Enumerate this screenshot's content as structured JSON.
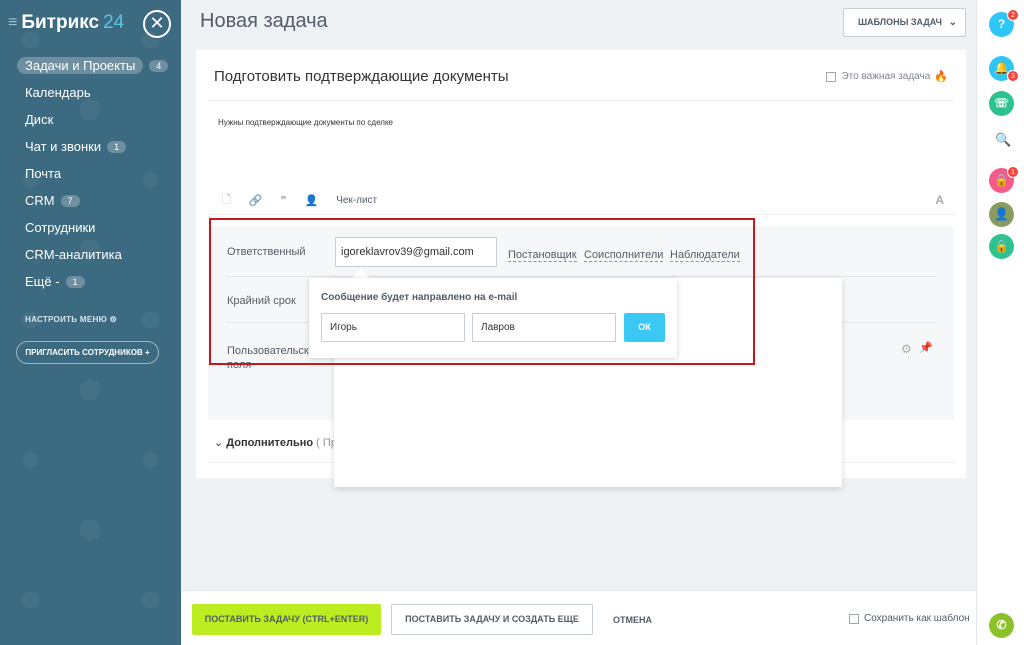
{
  "sidebar": {
    "logo_text": "Битрикс",
    "logo_num": "24",
    "items": [
      {
        "label": "Задачи и Проекты",
        "badge": "4"
      },
      {
        "label": "Календарь",
        "badge": ""
      },
      {
        "label": "Диск",
        "badge": ""
      },
      {
        "label": "Чат и звонки",
        "badge": "1"
      },
      {
        "label": "Почта",
        "badge": ""
      },
      {
        "label": "CRM",
        "badge": "7"
      },
      {
        "label": "Сотрудники",
        "badge": ""
      },
      {
        "label": "CRM-аналитика",
        "badge": ""
      },
      {
        "label": "Ещё -",
        "badge": "1"
      }
    ],
    "settings_label": "НАСТРОИТЬ МЕНЮ",
    "invite_label": "ПРИГЛАСИТЬ СОТРУДНИКОВ"
  },
  "header": {
    "title": "Новая задача",
    "templates_button": "ШАБЛОНЫ ЗАДАЧ"
  },
  "task": {
    "title": "Подготовить подтверждающие документы",
    "important_label": "Это важная задача",
    "description": "Нужны подтверждающие документы по сделке",
    "checklist_label": "Чек-лист"
  },
  "fields": {
    "responsible_label": "Ответственный",
    "responsible_value": "igoreklavrov39@gmail.com",
    "role_links": [
      "Постановщик",
      "Соисполнители",
      "Наблюдатели"
    ],
    "deadline_label": "Крайний срок",
    "custom_label_1": "Пользовательски",
    "custom_label_2": "поля",
    "extra_label": "Дополнительно",
    "extra_hint": "( Пр"
  },
  "popup": {
    "title": "Сообщение будет направлено на e-mail",
    "first_name": "Игорь",
    "last_name": "Лавров",
    "ok_label": "ОК"
  },
  "footer": {
    "submit_label": "ПОСТАВИТЬ ЗАДАЧУ (CTRL+ENTER)",
    "submit_more_label": "ПОСТАВИТЬ ЗАДАЧУ И СОЗДАТЬ ЕЩЕ",
    "cancel_label": "ОТМЕНА",
    "save_template_label": "Сохранить как шаблон"
  },
  "rightbar": {
    "help_badge": "2",
    "notify_badge": "3",
    "lock_badge": "1"
  },
  "colors": {
    "sidebar": "#3c6a80",
    "primary_button": "#bbed21",
    "ok_button": "#3bc8f5",
    "highlight": "#c4181f"
  }
}
